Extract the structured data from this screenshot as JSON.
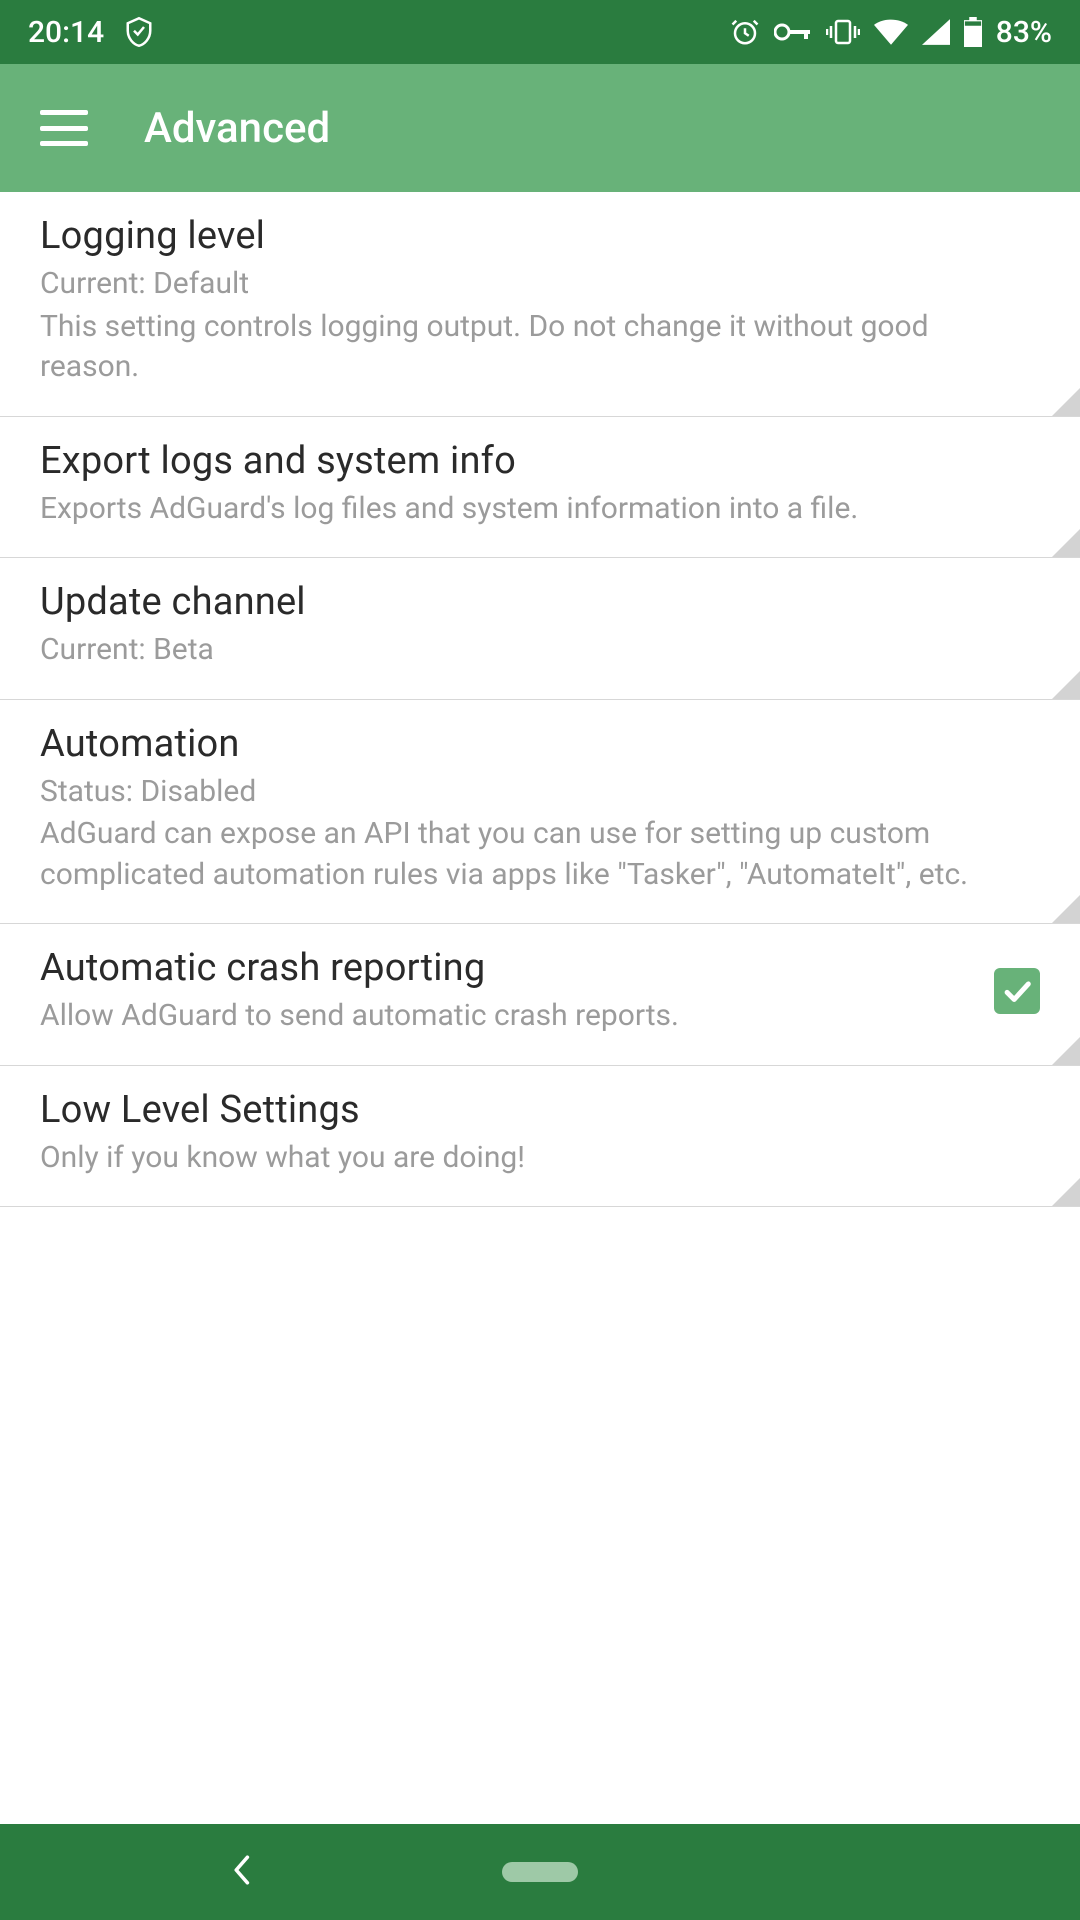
{
  "status": {
    "time": "20:14",
    "battery_pct": "83%"
  },
  "header": {
    "title": "Advanced"
  },
  "settings": [
    {
      "title": "Logging level",
      "sub1": "Current: Default",
      "sub2": "This setting controls logging output. Do not change it without good reason."
    },
    {
      "title": "Export logs and system info",
      "sub1": "Exports AdGuard's log files and system information into a file."
    },
    {
      "title": "Update channel",
      "sub1": "Current: Beta"
    },
    {
      "title": "Automation",
      "sub1": "Status: Disabled",
      "sub2": "AdGuard can expose an API that you can use for setting up custom complicated automation rules via apps like \"Tasker\", \"AutomateIt\", etc."
    },
    {
      "title": "Automatic crash reporting",
      "sub1": "Allow AdGuard to send automatic crash reports.",
      "checkbox": true
    },
    {
      "title": "Low Level Settings",
      "sub1": "Only if you know what you are doing!"
    }
  ]
}
